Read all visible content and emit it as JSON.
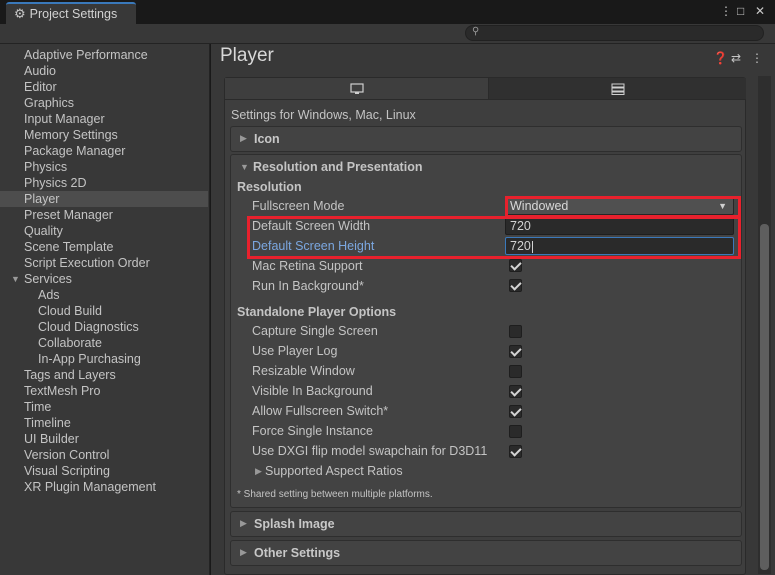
{
  "window": {
    "tab_title": "Project Settings",
    "tab_icon": "gear-icon",
    "menu_glyph": "⋮",
    "maximize_glyph": "□",
    "close_glyph": "✕",
    "search_placeholder": ""
  },
  "sidebar": {
    "items": [
      {
        "label": "Adaptive Performance"
      },
      {
        "label": "Audio"
      },
      {
        "label": "Editor"
      },
      {
        "label": "Graphics"
      },
      {
        "label": "Input Manager"
      },
      {
        "label": "Memory Settings"
      },
      {
        "label": "Package Manager"
      },
      {
        "label": "Physics"
      },
      {
        "label": "Physics 2D"
      },
      {
        "label": "Player",
        "selected": true
      },
      {
        "label": "Preset Manager"
      },
      {
        "label": "Quality"
      },
      {
        "label": "Scene Template"
      },
      {
        "label": "Script Execution Order"
      },
      {
        "label": "Services",
        "expanded": true
      },
      {
        "label": "Ads",
        "child": true
      },
      {
        "label": "Cloud Build",
        "child": true
      },
      {
        "label": "Cloud Diagnostics",
        "child": true
      },
      {
        "label": "Collaborate",
        "child": true
      },
      {
        "label": "In-App Purchasing",
        "child": true
      },
      {
        "label": "Tags and Layers"
      },
      {
        "label": "TextMesh Pro"
      },
      {
        "label": "Time"
      },
      {
        "label": "Timeline"
      },
      {
        "label": "UI Builder"
      },
      {
        "label": "Version Control"
      },
      {
        "label": "Visual Scripting"
      },
      {
        "label": "XR Plugin Management"
      }
    ]
  },
  "main": {
    "title": "Player",
    "header_icons": [
      "help-icon",
      "preset-icon",
      "more-icon"
    ],
    "platform_tabs": [
      {
        "name": "desktop-icon",
        "glyph": "🖵",
        "active": true
      },
      {
        "name": "dedicated-server-icon",
        "glyph": "☰",
        "active": false
      }
    ],
    "settings_for": "Settings for Windows, Mac, Linux",
    "icon_section": "Icon",
    "resolution_section": "Resolution and Presentation",
    "resolution_header": "Resolution",
    "fullscreen_mode": {
      "label": "Fullscreen Mode",
      "value": "Windowed"
    },
    "default_width": {
      "label": "Default Screen Width",
      "value": "720"
    },
    "default_height": {
      "label": "Default Screen Height",
      "value": "720"
    },
    "mac_retina": {
      "label": "Mac Retina Support",
      "checked": true
    },
    "run_in_background": {
      "label": "Run In Background*",
      "checked": true
    },
    "standalone_header": "Standalone Player Options",
    "standalone_options": [
      {
        "label": "Capture Single Screen",
        "checked": false
      },
      {
        "label": "Use Player Log",
        "checked": true
      },
      {
        "label": "Resizable Window",
        "checked": false
      },
      {
        "label": "Visible In Background",
        "checked": true
      },
      {
        "label": "Allow Fullscreen Switch*",
        "checked": true
      },
      {
        "label": "Force Single Instance",
        "checked": false
      },
      {
        "label": "Use DXGI flip model swapchain for D3D11",
        "checked": true
      }
    ],
    "aspect_ratios": "Supported Aspect Ratios",
    "footnote": "* Shared setting between multiple platforms.",
    "splash_section": "Splash Image",
    "other_section": "Other Settings"
  },
  "colors": {
    "highlight_box": "#e8212d",
    "accent_blue": "#3a79bb",
    "active_label": "#7ba7e0"
  }
}
